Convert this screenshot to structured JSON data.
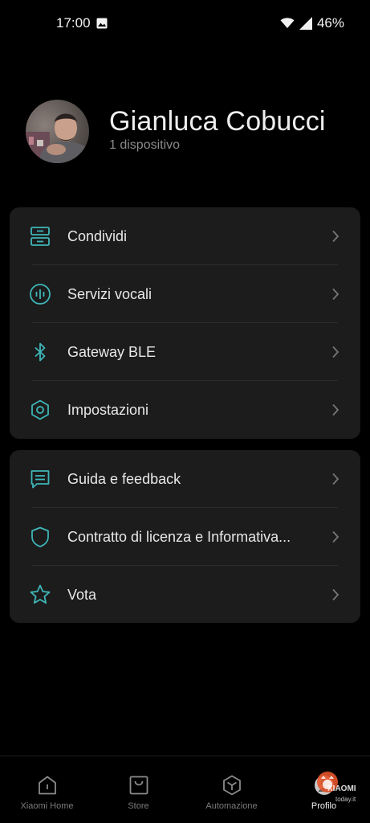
{
  "status_bar": {
    "time": "17:00",
    "battery": "46%",
    "icons": [
      "image-icon",
      "wifi-icon",
      "signal-icon"
    ]
  },
  "profile": {
    "name": "Gianluca Cobucci",
    "devices": "1 dispositivo"
  },
  "menu_group_1": [
    {
      "label": "Condividi",
      "icon": "share-drawer-icon"
    },
    {
      "label": "Servizi vocali",
      "icon": "voice-wave-icon"
    },
    {
      "label": "Gateway BLE",
      "icon": "bluetooth-icon"
    },
    {
      "label": "Impostazioni",
      "icon": "settings-hexagon-icon"
    }
  ],
  "menu_group_2": [
    {
      "label": "Guida e feedback",
      "icon": "feedback-message-icon"
    },
    {
      "label": "Contratto di licenza e Informativa...",
      "icon": "shield-icon"
    },
    {
      "label": "Vota",
      "icon": "star-icon"
    }
  ],
  "bottom_nav": [
    {
      "label": "Xiaomi Home",
      "icon": "home-icon",
      "active": false
    },
    {
      "label": "Store",
      "icon": "store-bag-icon",
      "active": false
    },
    {
      "label": "Automazione",
      "icon": "automation-cube-icon",
      "active": false
    },
    {
      "label": "Profilo",
      "icon": "profile-icon",
      "active": true
    }
  ],
  "watermark": {
    "line1": "XIAOMI",
    "line2": "today.it"
  },
  "colors": {
    "background": "#000000",
    "card": "#1c1c1c",
    "accent_icon": "#3fb6b8",
    "text_primary": "#e8e8e8",
    "text_secondary": "#8a8a8a"
  }
}
